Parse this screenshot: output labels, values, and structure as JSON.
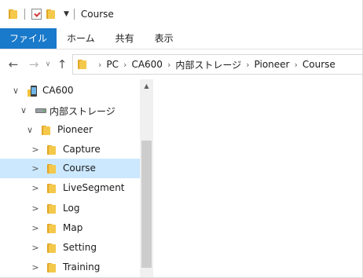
{
  "window": {
    "title": "Course"
  },
  "ribbon": {
    "tabs": [
      {
        "label": "ファイル"
      },
      {
        "label": "ホーム"
      },
      {
        "label": "共有"
      },
      {
        "label": "表示"
      }
    ]
  },
  "address": {
    "back": "←",
    "forward": "→",
    "up": "↑",
    "recent": "∨",
    "crumbs": [
      "PC",
      "CA600",
      "内部ストレージ",
      "Pioneer",
      "Course"
    ],
    "separator": "›"
  },
  "tree": [
    {
      "label": "CA600",
      "expander": "∨",
      "icon": "device-icon"
    },
    {
      "label": "内部ストレージ",
      "expander": "∨",
      "icon": "drive-icon"
    },
    {
      "label": "Pioneer",
      "expander": "∨",
      "icon": "folder-icon"
    },
    {
      "label": "Capture",
      "expander": ">",
      "icon": "folder-icon"
    },
    {
      "label": "Course",
      "expander": ">",
      "icon": "folder-icon",
      "selected": true
    },
    {
      "label": "LiveSegment",
      "expander": ">",
      "icon": "folder-icon"
    },
    {
      "label": "Log",
      "expander": ">",
      "icon": "folder-icon"
    },
    {
      "label": "Map",
      "expander": ">",
      "icon": "folder-icon"
    },
    {
      "label": "Setting",
      "expander": ">",
      "icon": "folder-icon"
    },
    {
      "label": "Training",
      "expander": ">",
      "icon": "folder-icon"
    }
  ],
  "colors": {
    "accent": "#1979ca",
    "selection": "#cce8ff",
    "folder": "#f4c84a"
  }
}
